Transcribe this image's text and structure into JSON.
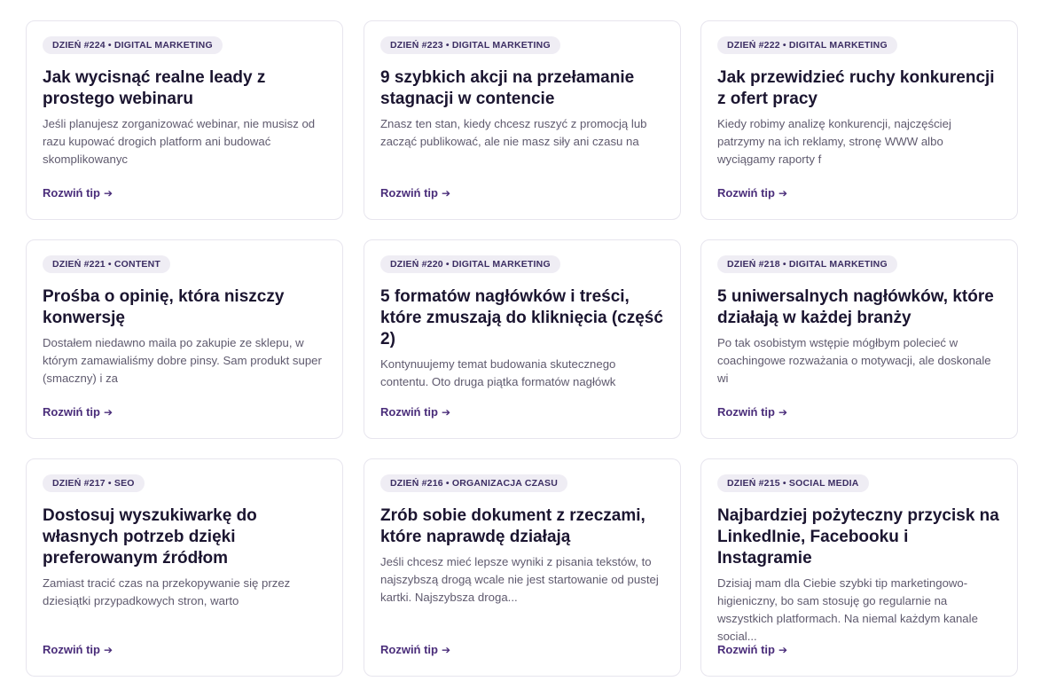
{
  "link_label": "Rozwiń tip",
  "arrow": "➔",
  "cards": [
    {
      "badge": "DZIEŃ #224 • DIGITAL MARKETING",
      "title": "Jak wycisnąć realne leady z prostego webinaru",
      "excerpt": "Jeśli planujesz zorganizować webinar, nie musisz od razu kupować drogich platform ani budować skomplikowanyc"
    },
    {
      "badge": "DZIEŃ #223 • DIGITAL MARKETING",
      "title": "9 szybkich akcji na przełamanie stagnacji w contencie",
      "excerpt": "Znasz ten stan, kiedy chcesz ruszyć z promocją lub zacząć publikować, ale nie masz siły ani czasu na"
    },
    {
      "badge": "DZIEŃ #222 • DIGITAL MARKETING",
      "title": "Jak przewidzieć ruchy konkurencji z ofert pracy",
      "excerpt": "Kiedy robimy analizę konkurencji, najczęściej patrzymy na ich reklamy, stronę WWW albo wyciągamy raporty f"
    },
    {
      "badge": "DZIEŃ #221 • CONTENT",
      "title": "Prośba o opinię, która niszczy konwersję",
      "excerpt": "Dostałem niedawno maila po zakupie ze sklepu, w którym zamawialiśmy dobre pinsy. Sam produkt super (smaczny) i za"
    },
    {
      "badge": "DZIEŃ #220 • DIGITAL MARKETING",
      "title": "5 formatów nagłówków i treści, które zmuszają do kliknięcia (część 2)",
      "excerpt": "Kontynuujemy temat budowania skutecznego contentu. Oto druga piątka formatów nagłówk"
    },
    {
      "badge": "DZIEŃ #218 • DIGITAL MARKETING",
      "title": "5 uniwersalnych nagłówków, które działają w każdej branży",
      "excerpt": "Po tak osobistym wstępie mógłbym polecieć w coachingowe rozważania o motywacji, ale doskonale wi"
    },
    {
      "badge": "DZIEŃ #217 • SEO",
      "title": "Dostosuj wyszukiwarkę do własnych potrzeb dzięki preferowanym źródłom",
      "excerpt": "Zamiast tracić czas na przekopywanie się przez dziesiątki przypadkowych stron, warto"
    },
    {
      "badge": "DZIEŃ #216 • ORGANIZACJA CZASU",
      "title": "Zrób sobie dokument z rzeczami, które naprawdę działają",
      "excerpt": "Jeśli chcesz mieć lepsze wyniki z pisania tekstów, to najszybszą drogą wcale nie jest startowanie od pustej kartki. Najszybsza droga..."
    },
    {
      "badge": "DZIEŃ #215 • SOCIAL MEDIA",
      "title": "Najbardziej pożyteczny przycisk na LinkedInie, Facebooku i Instagramie",
      "excerpt": "Dzisiaj mam dla Ciebie szybki tip marketingowo-higieniczny, bo sam stosuję go regularnie na wszystkich platformach. Na niemal każdym kanale social..."
    }
  ]
}
